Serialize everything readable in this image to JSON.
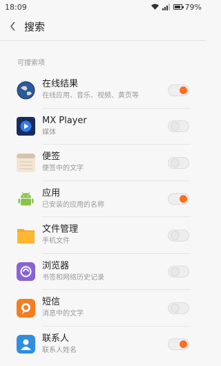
{
  "status_bar": {
    "time": "18:09",
    "battery": "79%"
  },
  "header": {
    "title": "搜索"
  },
  "section_label": "可搜索项",
  "items": [
    {
      "name": "在线结果",
      "desc": "在线应用、音乐、视频、黄页等",
      "enabled": true,
      "icon": "globe-icon"
    },
    {
      "name": "MX Player",
      "desc": "媒体",
      "enabled": false,
      "icon": "mx-player-icon"
    },
    {
      "name": "便签",
      "desc": "便签中的文字",
      "enabled": false,
      "icon": "notes-icon"
    },
    {
      "name": "应用",
      "desc": "已安装的应用的名称",
      "enabled": true,
      "icon": "android-icon"
    },
    {
      "name": "文件管理",
      "desc": "手机文件",
      "enabled": false,
      "icon": "folder-icon"
    },
    {
      "name": "浏览器",
      "desc": "书签和网络历史记录",
      "enabled": false,
      "icon": "browser-icon"
    },
    {
      "name": "短信",
      "desc": "消息中的文字",
      "enabled": false,
      "icon": "sms-icon"
    },
    {
      "name": "联系人",
      "desc": "联系人姓名",
      "enabled": true,
      "icon": "contacts-icon"
    }
  ],
  "colors": {
    "accent": "#ff6d1e"
  }
}
